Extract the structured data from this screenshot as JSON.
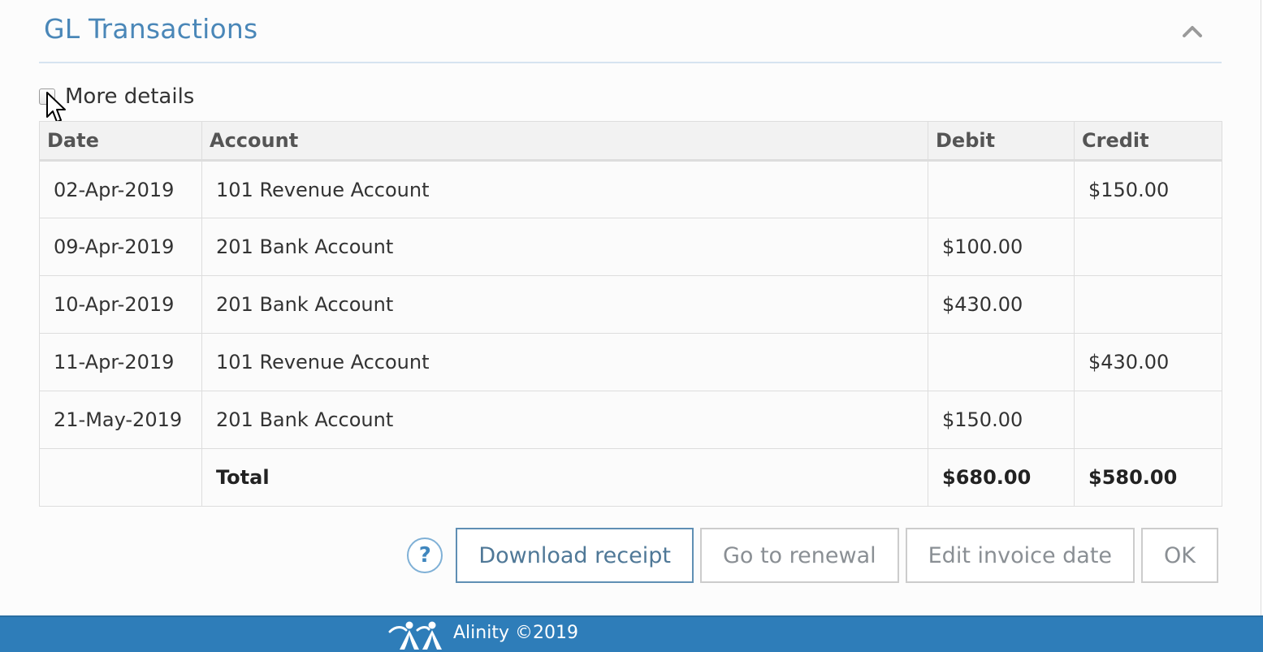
{
  "panel": {
    "title": "GL Transactions"
  },
  "options": {
    "more_details_label": "More details",
    "more_details_checked": false
  },
  "table": {
    "columns": [
      "Date",
      "Account",
      "Debit",
      "Credit"
    ],
    "rows": [
      {
        "date": "02-Apr-2019",
        "account": "101 Revenue Account",
        "debit": "",
        "credit": "$150.00"
      },
      {
        "date": "09-Apr-2019",
        "account": "201 Bank Account",
        "debit": "$100.00",
        "credit": ""
      },
      {
        "date": "10-Apr-2019",
        "account": "201 Bank Account",
        "debit": "$430.00",
        "credit": ""
      },
      {
        "date": "11-Apr-2019",
        "account": "101 Revenue Account",
        "debit": "",
        "credit": "$430.00"
      },
      {
        "date": "21-May-2019",
        "account": "201 Bank Account",
        "debit": "$150.00",
        "credit": ""
      }
    ],
    "total": {
      "date": "",
      "account": "Total",
      "debit": "$680.00",
      "credit": "$580.00"
    }
  },
  "actions": {
    "help_glyph": "?",
    "download_receipt": "Download receipt",
    "go_to_renewal": "Go to renewal",
    "edit_invoice_date": "Edit invoice date",
    "ok": "OK"
  },
  "footer": {
    "text": "Alinity ©2019"
  },
  "colors": {
    "title_blue": "#4a87b8",
    "footer_blue": "#2e7db9",
    "primary_border": "#5f8fb4"
  },
  "icons": {
    "collapse": "chevron-up-icon",
    "help": "question-circle-icon",
    "logo": "alinity-logo-icon",
    "cursor": "mouse-pointer-icon"
  }
}
